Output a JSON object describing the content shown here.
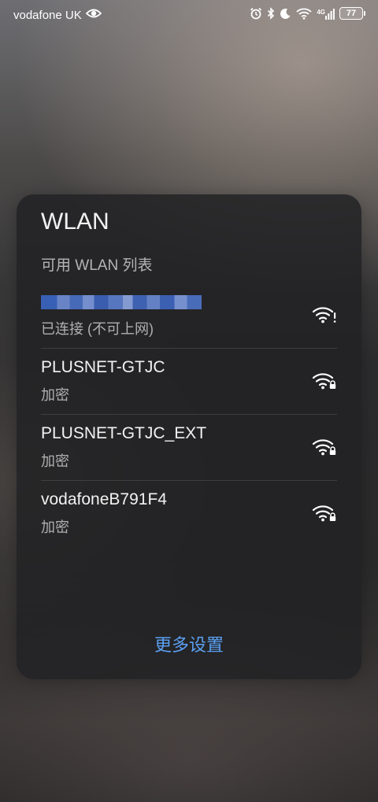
{
  "status_bar": {
    "carrier": "vodafone UK",
    "network_type": "4G",
    "battery_level": "77",
    "icons": [
      "eye-icon",
      "alarm-icon",
      "bluetooth-icon",
      "moon-icon",
      "wifi-icon",
      "cellular-signal-icon",
      "battery-icon"
    ]
  },
  "panel": {
    "title": "WLAN",
    "subtitle": "可用 WLAN 列表",
    "networks": [
      {
        "name": "",
        "status": "已连接 (不可上网)",
        "icon": "wifi-alert-icon",
        "redacted": true
      },
      {
        "name": "PLUSNET-GTJC",
        "status": "加密",
        "icon": "wifi-locked-icon"
      },
      {
        "name": "PLUSNET-GTJC_EXT",
        "status": "加密",
        "icon": "wifi-locked-icon"
      },
      {
        "name": "vodafoneB791F4",
        "status": "加密",
        "icon": "wifi-locked-icon"
      }
    ],
    "more_settings": "更多设置"
  },
  "colors": {
    "accent": "#5aa0f2",
    "panel_bg": "#222224"
  }
}
